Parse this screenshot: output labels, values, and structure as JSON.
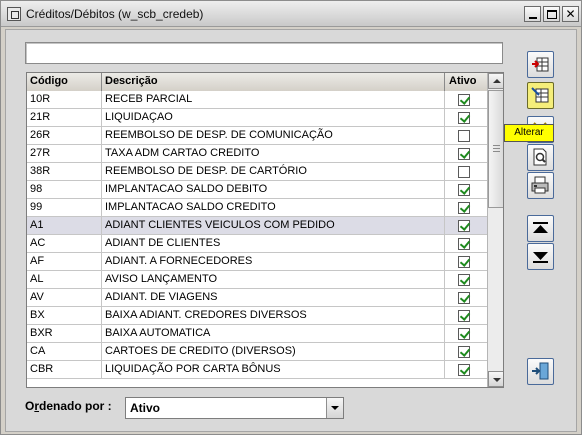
{
  "window": {
    "title": "Créditos/Débitos (w_scb_credeb)",
    "min_label": "",
    "max_label": "",
    "close_label": "✕"
  },
  "filter": {
    "value": "",
    "placeholder": ""
  },
  "grid": {
    "columns": {
      "code": "Código",
      "description": "Descrição",
      "active": "Ativo"
    },
    "rows": [
      {
        "code": "10R",
        "description": "RECEB PARCIAL",
        "active": true
      },
      {
        "code": "21R",
        "description": "LIQUIDAÇAO",
        "active": true
      },
      {
        "code": "26R",
        "description": "REEMBOLSO DE DESP. DE COMUNICAÇÃO",
        "active": false
      },
      {
        "code": "27R",
        "description": "TAXA ADM CARTAO CREDITO",
        "active": true
      },
      {
        "code": "38R",
        "description": "REEMBOLSO DE DESP. DE CARTÓRIO",
        "active": false
      },
      {
        "code": "98",
        "description": "IMPLANTACAO SALDO DEBITO",
        "active": true
      },
      {
        "code": "99",
        "description": "IMPLANTACAO SALDO CREDITO",
        "active": true
      },
      {
        "code": "A1",
        "description": "ADIANT CLIENTES VEICULOS COM PEDIDO",
        "active": true,
        "selected": true
      },
      {
        "code": "AC",
        "description": "ADIANT DE CLIENTES",
        "active": true
      },
      {
        "code": "AF",
        "description": "ADIANT. A FORNECEDORES",
        "active": true
      },
      {
        "code": "AL",
        "description": "AVISO LANÇAMENTO",
        "active": true
      },
      {
        "code": "AV",
        "description": "ADIANT. DE VIAGENS",
        "active": true
      },
      {
        "code": "BX",
        "description": "BAIXA ADIANT. CREDORES DIVERSOS",
        "active": true
      },
      {
        "code": "BXR",
        "description": "BAIXA AUTOMATICA",
        "active": true
      },
      {
        "code": "CA",
        "description": "CARTOES DE CREDITO (DIVERSOS)",
        "active": true
      },
      {
        "code": "CBR",
        "description": "LIQUIDAÇÃO POR CARTA BÔNUS",
        "active": true
      }
    ],
    "scroll_position": 0.0
  },
  "toolbar": {
    "tooltip": "Alterar",
    "buttons": [
      {
        "name": "insert-button",
        "icon": "insert-row-icon"
      },
      {
        "name": "edit-button",
        "icon": "edit-grid-icon",
        "active": true
      },
      {
        "name": "delete-button",
        "icon": "delete-icon"
      },
      {
        "name": "preview-button",
        "icon": "document-search-icon"
      },
      {
        "name": "print-button",
        "icon": "printer-icon"
      },
      {
        "name": "move-top-button",
        "icon": "move-top-icon"
      },
      {
        "name": "move-down-button",
        "icon": "move-down-icon"
      },
      {
        "name": "exit-button",
        "icon": "exit-door-icon"
      }
    ]
  },
  "order": {
    "label_prefix": "O",
    "label_accel": "r",
    "label_suffix": "denado por :",
    "selected": "Ativo"
  },
  "colors": {
    "selected_row": "#dcdce6",
    "checkbox_check": "#1d8a1d",
    "tooltip_bg": "#ffff00"
  }
}
